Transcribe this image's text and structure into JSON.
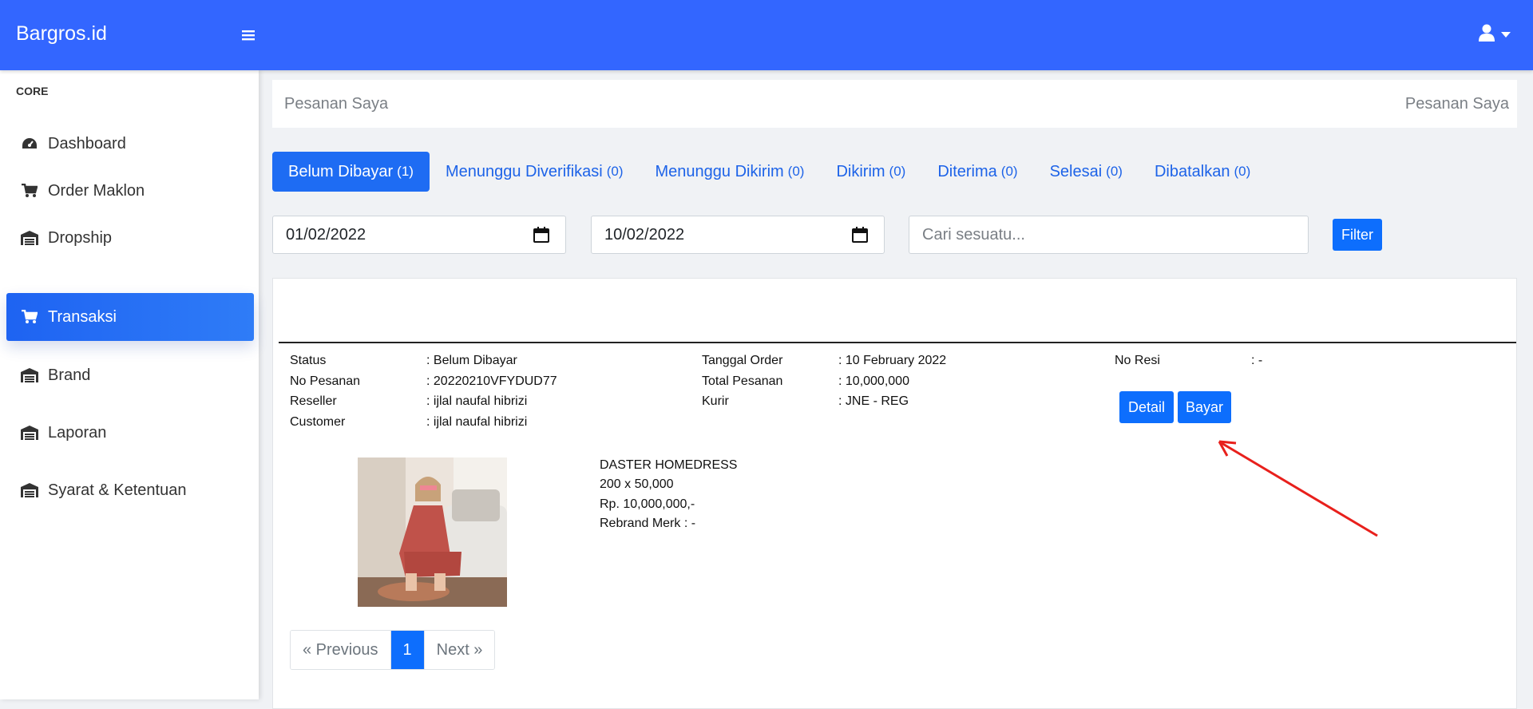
{
  "app": {
    "title": "Bargros.id"
  },
  "topbar": {
    "menu_icon": "bars-icon",
    "user_icon": "user-icon",
    "caret_icon": "caret-down-icon"
  },
  "sidebar": {
    "heading": "CORE",
    "items": [
      {
        "label": "Dashboard",
        "icon": "tachometer-icon"
      },
      {
        "label": "Order Maklon",
        "icon": "cart-icon"
      },
      {
        "label": "Dropship",
        "icon": "warehouse-icon"
      },
      {
        "label": "Transaksi",
        "icon": "cart-icon",
        "active": true
      },
      {
        "label": "Brand",
        "icon": "warehouse-icon"
      },
      {
        "label": "Laporan",
        "icon": "warehouse-icon"
      },
      {
        "label": "Syarat & Ketentuan",
        "icon": "warehouse-icon"
      }
    ]
  },
  "page": {
    "title": "Pesanan Saya",
    "breadcrumb": "Pesanan Saya"
  },
  "tabs": [
    {
      "label": "Belum Dibayar",
      "count": "(1)",
      "active": true
    },
    {
      "label": "Menunggu Diverifikasi",
      "count": "(0)"
    },
    {
      "label": "Menunggu Dikirim",
      "count": "(0)"
    },
    {
      "label": "Dikirim",
      "count": "(0)"
    },
    {
      "label": "Diterima",
      "count": "(0)"
    },
    {
      "label": "Selesai",
      "count": "(0)"
    },
    {
      "label": "Dibatalkan",
      "count": "(0)"
    }
  ],
  "filters": {
    "date_from": "01/02/2022",
    "date_to": "10/02/2022",
    "search_placeholder": "Cari sesuatu...",
    "filter_label": "Filter"
  },
  "order": {
    "status_label": "Status",
    "status_value": ": Belum Dibayar",
    "number_label": "No Pesanan",
    "number_value": ": 20220210VFYDUD77",
    "reseller_label": "Reseller",
    "reseller_value": ": ijlal naufal hibrizi",
    "customer_label": "Customer",
    "customer_value": ": ijlal naufal hibrizi",
    "date_label": "Tanggal Order",
    "date_value": ": 10 February 2022",
    "total_label": "Total Pesanan",
    "total_value": ": 10,000,000",
    "courier_label": "Kurir",
    "courier_value": ": JNE - REG",
    "resi_label": "No Resi",
    "resi_value": ": -",
    "detail_label": "Detail",
    "pay_label": "Bayar",
    "product": {
      "name": "DASTER HOMEDRESS",
      "qty_price": "200 x 50,000",
      "subtotal": "Rp. 10,000,000,-",
      "rebrand": "Rebrand Merk : -"
    }
  },
  "pagination": {
    "previous": "« Previous",
    "current": "1",
    "next": "Next »"
  },
  "colors": {
    "primary": "#3366ff",
    "button": "#0d6efd",
    "annotation_arrow": "#e8201c"
  }
}
